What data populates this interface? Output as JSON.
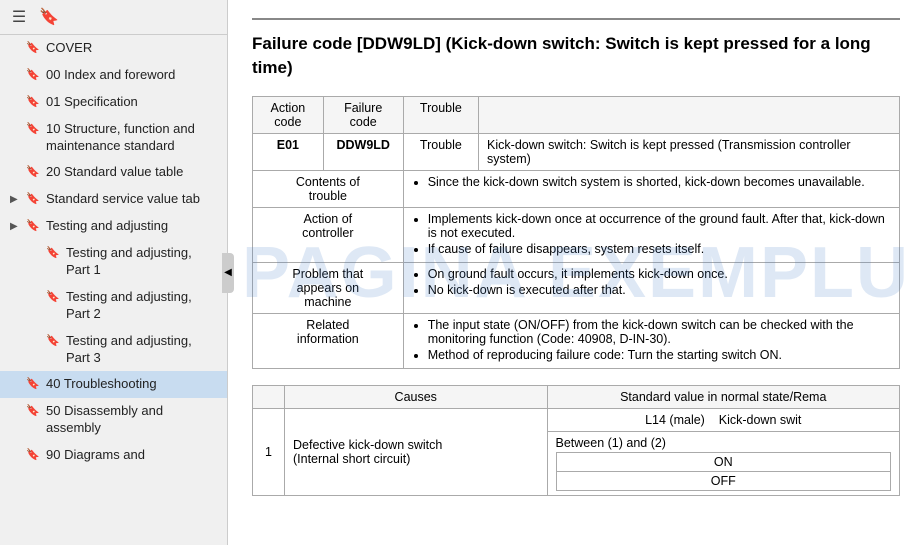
{
  "sidebar": {
    "toolbar": {
      "icon1": "☰",
      "icon2": "🔖"
    },
    "items": [
      {
        "label": "COVER",
        "indent": 0,
        "expandable": false,
        "bookmark": true
      },
      {
        "label": "00 Index and foreword",
        "indent": 0,
        "expandable": false,
        "bookmark": true
      },
      {
        "label": "01 Specification",
        "indent": 0,
        "expandable": false,
        "bookmark": true
      },
      {
        "label": "10 Structure, function and maintenance standard",
        "indent": 0,
        "expandable": false,
        "bookmark": true
      },
      {
        "label": "20 Standard value table",
        "indent": 0,
        "expandable": false,
        "bookmark": true
      },
      {
        "label": "Standard service value tab",
        "indent": 0,
        "expandable": true,
        "bookmark": true
      },
      {
        "label": "Testing and adjusting",
        "indent": 0,
        "expandable": true,
        "bookmark": true
      },
      {
        "label": "Testing and adjusting, Part 1",
        "indent": 1,
        "expandable": false,
        "bookmark": true
      },
      {
        "label": "Testing and adjusting, Part 2",
        "indent": 1,
        "expandable": false,
        "bookmark": true
      },
      {
        "label": "Testing and adjusting, Part 3",
        "indent": 1,
        "expandable": false,
        "bookmark": true
      },
      {
        "label": "40 Troubleshooting",
        "indent": 0,
        "expandable": false,
        "bookmark": true,
        "active": true
      },
      {
        "label": "50 Disassembly and assembly",
        "indent": 0,
        "expandable": false,
        "bookmark": true
      },
      {
        "label": "90 Diagrams and",
        "indent": 0,
        "expandable": false,
        "bookmark": true
      }
    ]
  },
  "main": {
    "title": "Failure code [DDW9LD] (Kick-down switch: Switch is kept pressed for a long time)",
    "divider": true,
    "info_table": {
      "headers": [
        "Action code",
        "Failure code",
        "Trouble"
      ],
      "action_code": "E01",
      "failure_code": "DDW9LD",
      "trouble": "Kick-down switch: Switch is kept pressed (Transmission controller system)",
      "rows": [
        {
          "label": "Contents of trouble",
          "content": "Since the kick-down switch system is shorted, kick-down becomes unavailable."
        },
        {
          "label": "Action of controller",
          "content": "Implements kick-down once at occurrence of the ground fault. After that, kick-down is not executed.\nIf cause of failure disappears, system resets itself."
        },
        {
          "label": "Problem that appears on machine",
          "content": "On ground fault occurs, it implements kick-down once.\nNo kick-down is executed after that."
        },
        {
          "label": "Related information",
          "content1": "The input state (ON/OFF) from the kick-down switch can be checked with the monitoring function (Code: 40908, D-IN-30).",
          "content2": "Method of reproducing failure code: Turn the starting switch ON."
        }
      ]
    },
    "causes_table": {
      "headers": [
        "",
        "Causes",
        "Standard value in normal state/Rema"
      ],
      "rows": [
        {
          "number": "1",
          "cause": "Defective kick-down switch (Internal short circuit)",
          "sub_rows": [
            {
              "sub_label": "L14 (male)",
              "col": "Kick-down swit"
            },
            {
              "sub_label": "Between (1) and (2)",
              "values": [
                "ON",
                "OFF"
              ]
            }
          ]
        }
      ]
    },
    "watermark": "PAGINA EXEMPLU"
  }
}
